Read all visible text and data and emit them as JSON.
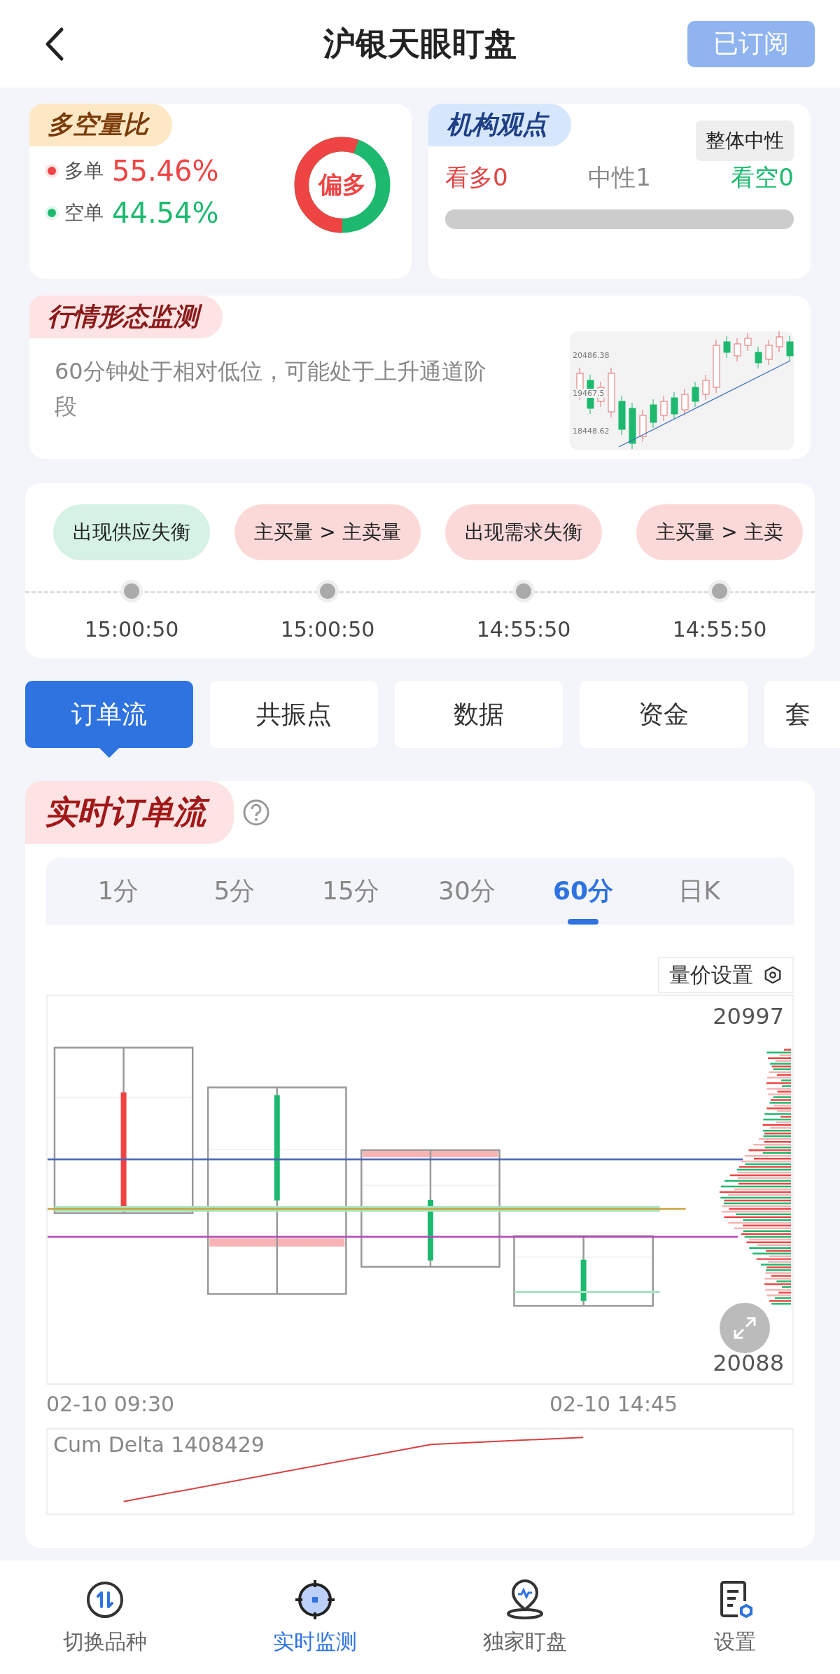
{
  "header": {
    "title": "沪银天眼盯盘",
    "subscribe_button": "已订阅"
  },
  "ratio_card": {
    "title": "多空量比",
    "rows": [
      {
        "label": "多单",
        "value": "55.46%",
        "color": "#ef4444"
      },
      {
        "label": "空单",
        "value": "44.54%",
        "color": "#1db96f"
      }
    ],
    "ring": {
      "label": "偏多",
      "level": 0.5546
    }
  },
  "institution_card": {
    "title": "机构观点",
    "badge": "整体中性",
    "counts": [
      {
        "label": "看多0",
        "kind": "bull"
      },
      {
        "label": "中性1",
        "kind": "neutral"
      },
      {
        "label": "看空0",
        "kind": "bear"
      }
    ]
  },
  "pattern_card": {
    "title": "行情形态监测",
    "text": "60分钟处于相对低位，可能处于上升通道阶段",
    "mini_chart_labels": [
      "20486.38",
      "19467.5",
      "18448.62"
    ]
  },
  "timeline": [
    {
      "label": "出现供应失衡",
      "time": "15:00:50",
      "color": "#d5f2e4"
    },
    {
      "label": "主买量 > 主卖量",
      "time": "15:00:50",
      "color": "#fcd9d9"
    },
    {
      "label": "出现需求失衡",
      "time": "14:55:50",
      "color": "#fcd9d9"
    },
    {
      "label": "主买量 > 主卖",
      "time": "14:55:50",
      "color": "#fcd9d9"
    }
  ],
  "tabs": [
    {
      "label": "订单流",
      "selected": true
    },
    {
      "label": "共振点",
      "selected": false
    },
    {
      "label": "数据",
      "selected": false
    },
    {
      "label": "资金",
      "selected": false
    },
    {
      "label": "套",
      "selected": false
    }
  ],
  "orderflow": {
    "title": "实时订单流",
    "periods": [
      {
        "label": "1分",
        "selected": false
      },
      {
        "label": "5分",
        "selected": false
      },
      {
        "label": "15分",
        "selected": false
      },
      {
        "label": "30分",
        "selected": false
      },
      {
        "label": "60分",
        "selected": true
      },
      {
        "label": "日K",
        "selected": false
      }
    ],
    "settings_button": "量价设置",
    "price_high": "20997",
    "price_low": "20088",
    "x_labels": [
      "02-10 09:30",
      "02-10 14:45"
    ],
    "cum_delta": "Cum Delta 1408429"
  },
  "bottom_nav": [
    {
      "label": "切换品种",
      "kind": "switch",
      "selected": false
    },
    {
      "label": "实时监测",
      "kind": "target",
      "selected": true
    },
    {
      "label": "独家盯盘",
      "kind": "pin",
      "selected": false
    },
    {
      "label": "设置",
      "kind": "settings",
      "selected": false
    }
  ]
}
